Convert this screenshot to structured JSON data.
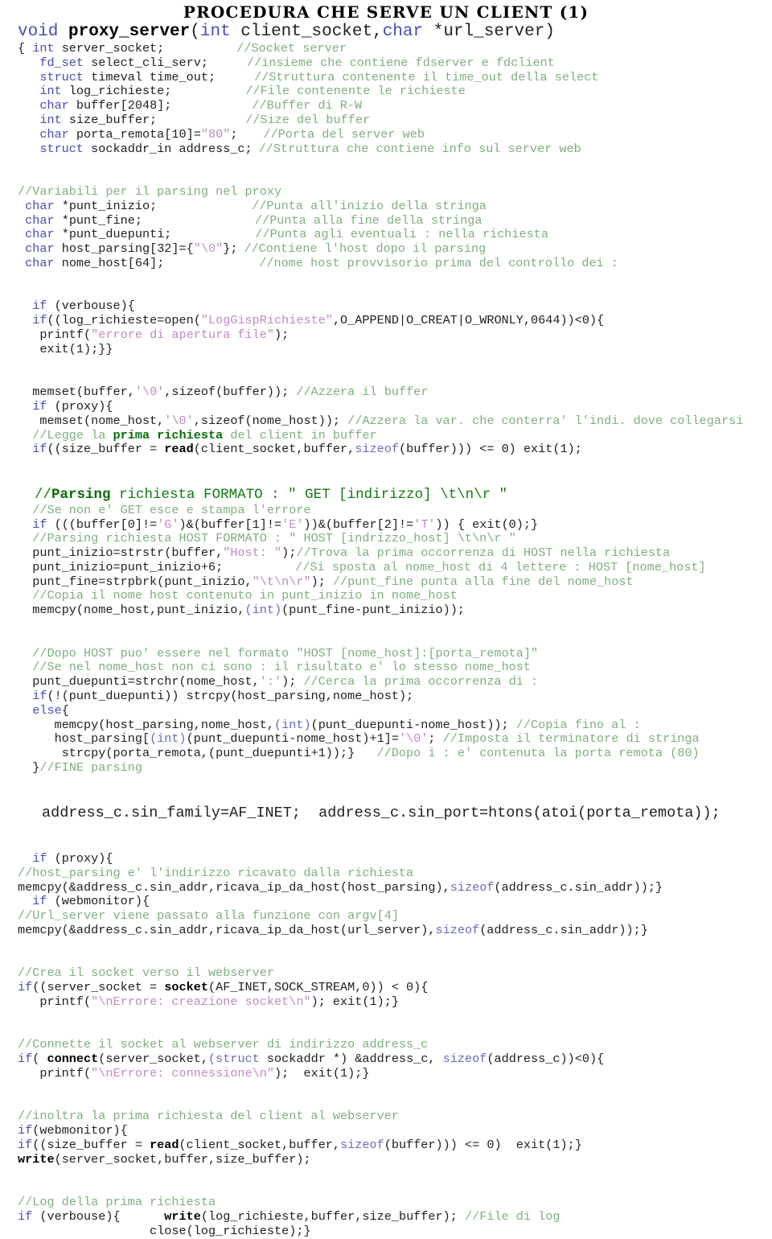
{
  "slide": {
    "title": "PROCEDURA CHE SERVE UN CLIENT (1)",
    "signature": {
      "kw_void": "void ",
      "fname": "proxy_server",
      "paren_open": "(",
      "kw_int": "int",
      "arg1": " client_socket,",
      "kw_char": "char",
      "arg2": " *url_server)"
    },
    "decl_block": {
      "l1_brace": "{ ",
      "l1_kw": "int",
      "l1_rest": " server_socket;",
      "l1_cmt": "//Socket server",
      "l2_kw": "fd_set",
      "l2_rest": " select_cli_serv;",
      "l2_cmt": "//insieme che contiene fdserver e fdclient",
      "l3_kw": "struct",
      "l3_rest": " timeval time_out;",
      "l3_cmt": "//Struttura contenente il time_out della select",
      "l4_kw": "int",
      "l4_rest": " log_richieste;",
      "l4_cmt": "//File contenente le richieste",
      "l5_kw": "char",
      "l5_rest": " buffer[2048];",
      "l5_cmt": "//Buffer di R-W",
      "l6_kw": "int",
      "l6_rest": " size_buffer;",
      "l6_cmt": "//Size del buffer",
      "l7_kw": "char",
      "l7_rest": " porta_remota[10]=",
      "l7_str": "\"80\"",
      "l7_end": ";",
      "l7_cmt": "//Porta del server web",
      "l8_kw": "struct",
      "l8_rest": " sockaddr_in address_c;",
      "l8_cmt": "//Struttura che contiene info sul server web"
    },
    "parse_vars": {
      "hdr": "//Variabili per il parsing nel proxy",
      "v1_kw": "char",
      "v1_rest": " *punt_inizio;",
      "v1_cmt": "//Punta all'inizio della stringa",
      "v2_kw": "char",
      "v2_rest": " *punt_fine;",
      "v2_cmt": "//Punta alla fine della stringa",
      "v3_kw": "char",
      "v3_rest": " *punt_duepunti;",
      "v3_cmt": "//Punta agli eventuali : nella richiesta",
      "v4_kw": "char",
      "v4_rest": " host_parsing[32]={",
      "v4_str": "\"\\0\"",
      "v4_end": "};",
      "v4_cmt": "//Contiene l'host dopo il parsing",
      "v5_kw": "char",
      "v5_rest": " nome_host[64];",
      "v5_cmt": "//nome host provvisorio prima del controllo dei :"
    },
    "verbose_block": {
      "l1_kw": "if",
      "l1_rest": " (verbouse){",
      "l2_kw": "if",
      "l2_rest": "((log_richieste=open(",
      "l2_str": "\"LogGispRichieste\"",
      "l2_end": ",O_APPEND|O_CREAT|O_WRONLY,0644))<0){",
      "l3_pre": "printf(",
      "l3_str": "\"errore di apertura file\"",
      "l3_end": ");",
      "l4": "exit(1);}}"
    },
    "memset_block": {
      "l1_pre": "memset(buffer,",
      "l1_str": "'\\0'",
      "l1_mid": ",sizeof(buffer)); ",
      "l1_cmt": "//Azzera il buffer",
      "l2_kw": "if",
      "l2_rest": " (proxy){",
      "l3_pre": "memset(nome_host,",
      "l3_str": "'\\0'",
      "l3_mid": ",sizeof(nome_host)); ",
      "l3_cmt": "//Azzera la var. che conterra' l’indi. dove collegarsi",
      "l4_c1": "//Legge la ",
      "l4_cb": "prima richiesta",
      "l4_c2": " del client in buffer",
      "l5_kw": "if",
      "l5_a": "((size_buffer = ",
      "l5_b": "read",
      "l5_c": "(client_socket,buffer,",
      "l5_d": "sizeof",
      "l5_e": "(buffer))) <= 0) exit(1);"
    },
    "parsing_block": {
      "h1_pre": "//",
      "h1_bold": "Parsing",
      "h1_rest": " richiesta FORMATO : \" GET [indirizzo] \\t\\n\\r \"",
      "h2": "//Se non e' GET esce e stampa l'errore",
      "l1_kw": "if",
      "l1_a": " (((buffer[0]!=",
      "l1_s1": "'G'",
      "l1_b": ")&(buffer[1]!=",
      "l1_s2": "'E'",
      "l1_c": "))&(buffer[2]!=",
      "l1_s3": "'T'",
      "l1_d": ")) { exit(0);}",
      "l2_cmt": "//Parsing richiesta HOST FORMATO : \" HOST [indrizzo_host] \\t\\n\\r \"",
      "l3_pre": "punt_inizio=strstr(buffer,",
      "l3_str": "\"Host: \"",
      "l3_mid": ");",
      "l3_cmt": "//Trova la prima occorrenza di HOST nella richiesta",
      "l4_pre": "punt_inizio=punt_inizio+6;",
      "l4_cmt": "//Si sposta al nome_host di 4 lettere : HOST [nome_host]",
      "l5_pre": "punt_fine=strpbrk(punt_inizio,",
      "l5_str": "\"\\t\\n\\r\"",
      "l5_mid": "); ",
      "l5_cmt": "//punt_fine punta alla fine del nome_host",
      "l6_cmt": "//Copia il nome host contenuto in punt_inizio in nome_host",
      "l7_pre": "memcpy(nome_host,punt_inizio,",
      "l7_kw": "(int)",
      "l7_end": "(punt_fine-punt_inizio));"
    },
    "host_block": {
      "c1": "//Dopo HOST puo' essere nel formato \"HOST [nome_host]:[porta_remota]\"",
      "c2": "//Se nel nome_host non ci sono : il risultato e' lo stesso nome_host",
      "l1_pre": "punt_duepunti=strchr(nome_host,",
      "l1_str": "':'",
      "l1_mid": "); ",
      "l1_cmt": "//Cerca la prima occorrenza di :",
      "l2_kw": "if",
      "l2_rest": "(!(punt_duepunti)) strcpy(host_parsing,nome_host);",
      "l3_kw": "else",
      "l3_rest": "{",
      "l4_pre": "memcpy(host_parsing,nome_host,",
      "l4_kw": "(int)",
      "l4_mid": "(punt_duepunti-nome_host)); ",
      "l4_cmt": "//Copia fino al :",
      "l5_pre": "host_parsing[",
      "l5_kw": "(int)",
      "l5_mid": "(punt_duepunti-nome_host)+1]=",
      "l5_str": "'\\0'",
      "l5_semi": "; ",
      "l5_cmt": "//Imposta il terminatore di stringa",
      "l6_pre": "strcpy(porta_remota,(punt_duepunti+1));}   ",
      "l6_cmt": "//Dopo i : e' contenuta la porta remota (80)",
      "l7_pre": "}",
      "l7_cmt": "//FINE parsing"
    },
    "address_line": "address_c.sin_family=AF_INET;  address_c.sin_port=htons(atoi(porta_remota));",
    "proxy_block": {
      "l1_kw": "if",
      "l1_rest": " (proxy){",
      "l2_cmt": "//host_parsing e' l'indirizzo ricavato dalla richiesta",
      "l3_pre": "memcpy(&address_c.sin_addr,ricava_ip_da_host(host_parsing),",
      "l3_kw": "sizeof",
      "l3_end": "(address_c.sin_addr));}",
      "l4_kw": "if",
      "l4_rest": " (webmonitor){",
      "l5_cmt": "//Url_server viene passato alla funzione con argv[4]",
      "l6_pre": "memcpy(&address_c.sin_addr,ricava_ip_da_host(url_server),",
      "l6_kw": "sizeof",
      "l6_end": "(address_c.sin_addr));}"
    },
    "socket_block": {
      "c1": "//Crea il socket verso il webserver",
      "l1_kw": "if",
      "l1_a": "((server_socket = ",
      "l1_b": "socket",
      "l1_c": "(AF_INET,SOCK_STREAM,0)) < 0){",
      "l2_pre": "printf(",
      "l2_str": "\"\\nErrore: creazione socket\\n\"",
      "l2_end": "); exit(1);}"
    },
    "connect_block": {
      "c1": "//Connette il socket al webserver di indirizzo address_c",
      "l1_kw": "if",
      "l1_a": "( ",
      "l1_b": "connect",
      "l1_c": "(server_socket,",
      "l1_kw2": "(struct",
      "l1_d": " sockaddr *) &address_c, ",
      "l1_kw3": "sizeof",
      "l1_e": "(address_c))<0){",
      "l2_pre": "printf(",
      "l2_str": "\"\\nErrore: connessione\\n\"",
      "l2_end": ");  exit(1);}"
    },
    "forward_block": {
      "c1": "//inoltra la prima richiesta del client al webserver",
      "l1_kw": "if",
      "l1_rest": "(webmonitor){",
      "l2_kw": "if",
      "l2_a": "((size_buffer = ",
      "l2_b": "read",
      "l2_c": "(client_socket,buffer,",
      "l2_d": "sizeof",
      "l2_e": "(buffer))) <= 0)  exit(1);}",
      "l3_b": "write",
      "l3_rest": "(server_socket,buffer,size_buffer);"
    },
    "log_block": {
      "c1": "//Log della prima richiesta",
      "l1_kw": "if",
      "l1_a": " (verbouse){      ",
      "l1_b": "write",
      "l1_c": "(log_richieste,buffer,size_buffer); ",
      "l1_cmt": "//File di log",
      "l2": "                  close(log_richieste);}"
    }
  },
  "colors": {
    "keyword": "#4a4ab8",
    "comment_light": "#7fae7f",
    "comment_dark": "#117a11",
    "string": "#c08ac0",
    "text": "#202020",
    "background": "#ffffff"
  }
}
